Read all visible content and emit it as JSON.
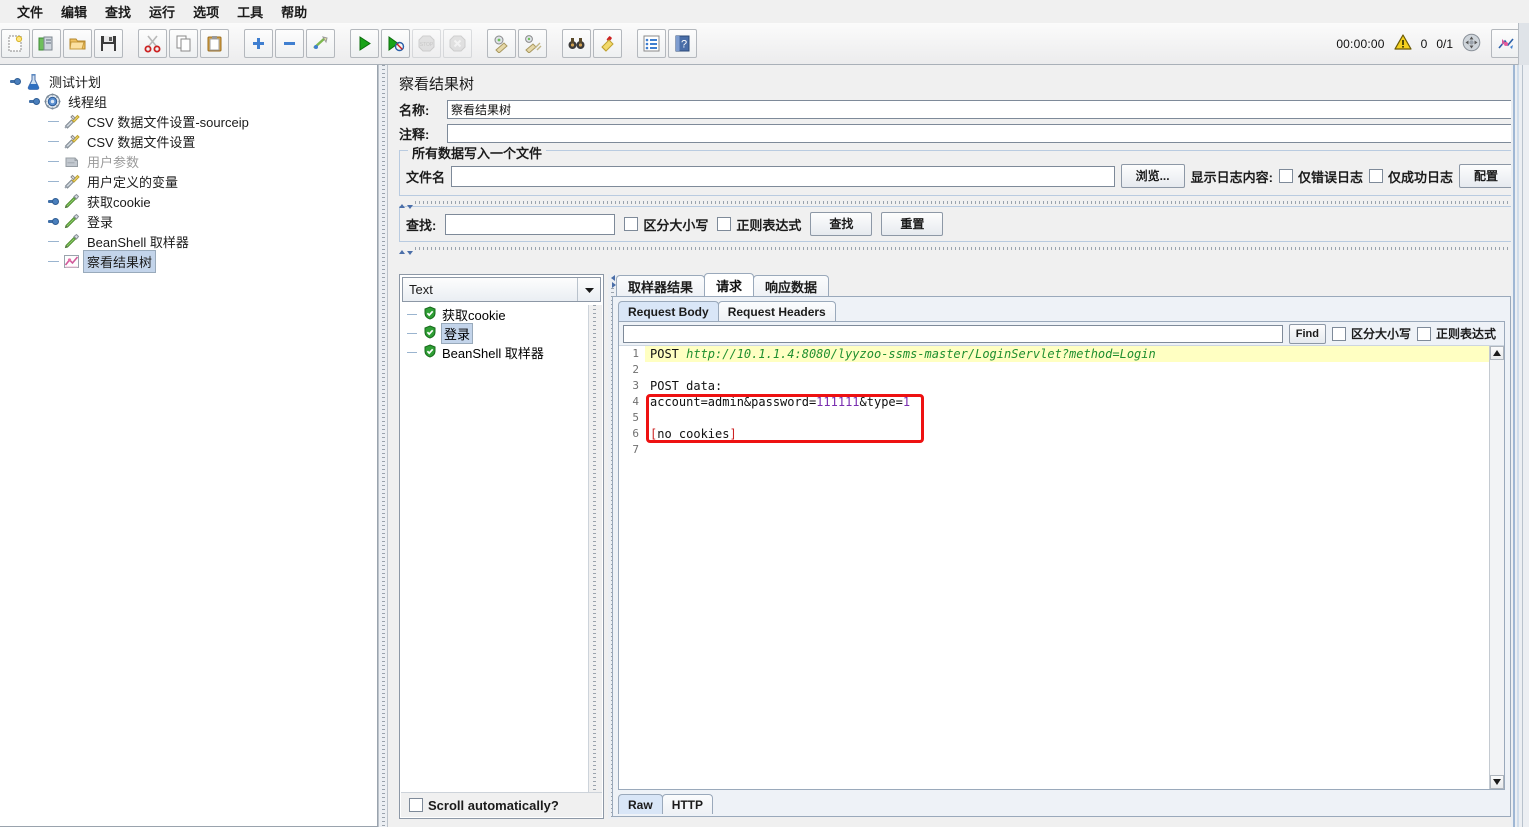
{
  "menu": {
    "items": [
      {
        "label": "文件",
        "name": "menu-file"
      },
      {
        "label": "编辑",
        "name": "menu-edit"
      },
      {
        "label": "查找",
        "name": "menu-search"
      },
      {
        "label": "运行",
        "name": "menu-run"
      },
      {
        "label": "选项",
        "name": "menu-options"
      },
      {
        "label": "工具",
        "name": "menu-tools"
      },
      {
        "label": "帮助",
        "name": "menu-help"
      }
    ]
  },
  "toolbar": {
    "buttons": [
      {
        "icon": "new-file-icon",
        "enabled": true
      },
      {
        "icon": "templates-icon",
        "enabled": true
      },
      {
        "icon": "open-folder-icon",
        "enabled": true
      },
      {
        "icon": "save-icon",
        "enabled": true
      },
      {
        "icon": "cut-scissors-icon",
        "enabled": true
      },
      {
        "icon": "copy-icon",
        "enabled": true
      },
      {
        "icon": "paste-clipboard-icon",
        "enabled": true
      },
      {
        "icon": "expand-plus-icon",
        "enabled": true
      },
      {
        "icon": "collapse-minus-icon",
        "enabled": true
      },
      {
        "icon": "toggle-icon",
        "enabled": true
      },
      {
        "icon": "start-play-icon",
        "enabled": true
      },
      {
        "icon": "start-no-pauses-icon",
        "enabled": true
      },
      {
        "icon": "stop-icon",
        "enabled": false
      },
      {
        "icon": "shutdown-icon",
        "enabled": false
      },
      {
        "icon": "clear-icon",
        "enabled": true
      },
      {
        "icon": "clear-all-icon",
        "enabled": true
      },
      {
        "icon": "search-binoculars-icon",
        "enabled": true
      },
      {
        "icon": "search-reset-broom-icon",
        "enabled": true
      },
      {
        "icon": "function-helper-list-icon",
        "enabled": true
      },
      {
        "icon": "help-book-icon",
        "enabled": true
      }
    ],
    "status": {
      "elapsed": "00:00:00",
      "warning_icon": "warning-triangle-icon",
      "warning_count": "0",
      "threads": "0/1",
      "remote_icon": "remote-status-icon",
      "right_icon": "jmeter-logo-icon"
    }
  },
  "tree": {
    "nodes": [
      {
        "label": "测试计划",
        "icon": "test-plan-icon",
        "depth": 0,
        "selected": false,
        "expandable": true,
        "muted": false
      },
      {
        "label": "线程组",
        "icon": "thread-group-icon",
        "depth": 1,
        "selected": false,
        "expandable": true,
        "muted": false
      },
      {
        "label": "CSV 数据文件设置-sourceip",
        "icon": "config-element-icon",
        "depth": 2,
        "selected": false,
        "expandable": false,
        "muted": false
      },
      {
        "label": "CSV 数据文件设置",
        "icon": "config-element-icon",
        "depth": 2,
        "selected": false,
        "expandable": false,
        "muted": false
      },
      {
        "label": "用户参数",
        "icon": "user-parameters-icon",
        "depth": 2,
        "selected": false,
        "expandable": false,
        "muted": true
      },
      {
        "label": "用户定义的变量",
        "icon": "config-element-icon",
        "depth": 2,
        "selected": false,
        "expandable": false,
        "muted": false
      },
      {
        "label": "获取cookie",
        "icon": "sampler-icon",
        "depth": 2,
        "selected": false,
        "expandable": true,
        "muted": false
      },
      {
        "label": "登录",
        "icon": "sampler-icon",
        "depth": 2,
        "selected": false,
        "expandable": true,
        "muted": false
      },
      {
        "label": "BeanShell 取样器",
        "icon": "sampler-icon",
        "depth": 2,
        "selected": false,
        "expandable": false,
        "muted": false
      },
      {
        "label": "察看结果树",
        "icon": "view-results-tree-icon",
        "depth": 2,
        "selected": true,
        "expandable": false,
        "muted": false
      }
    ]
  },
  "panel": {
    "title": "察看结果树",
    "name_label": "名称:",
    "name_value": "察看结果树",
    "comment_label": "注释:",
    "comment_value": "",
    "filegroup": {
      "title": "所有数据写入一个文件",
      "filename_label": "文件名",
      "filename_value": "",
      "browse_button": "浏览...",
      "log_label": "显示日志内容:",
      "errors_only": "仅错误日志",
      "success_only": "仅成功日志",
      "configure_button": "配置"
    },
    "searchbar": {
      "label": "查找:",
      "value": "",
      "case_sensitive": "区分大小写",
      "regex": "正则表达式",
      "find_button": "查找",
      "reset_button": "重置"
    }
  },
  "results": {
    "renderer_selected": "Text",
    "renderer_icon": "chevron-down-icon",
    "items": [
      {
        "label": "获取cookie",
        "status": "success",
        "selected": false
      },
      {
        "label": "登录",
        "status": "success",
        "selected": true
      },
      {
        "label": "BeanShell 取样器",
        "status": "success",
        "selected": false
      }
    ],
    "scroll_auto_label": "Scroll automatically?",
    "scroll_auto_checked": false
  },
  "detail": {
    "tabs": [
      {
        "label": "取样器结果",
        "active": false
      },
      {
        "label": "请求",
        "active": true
      },
      {
        "label": "响应数据",
        "active": false
      }
    ],
    "subtabs": [
      {
        "label": "Request Body",
        "active": true
      },
      {
        "label": "Request Headers",
        "active": false
      }
    ],
    "find": {
      "value": "",
      "find_button": "Find",
      "case_sensitive": "区分大小写",
      "regex": "正则表达式"
    },
    "bottom_tabs": [
      {
        "label": "Raw",
        "active": true
      },
      {
        "label": "HTTP",
        "active": false
      }
    ],
    "code_lines": [
      {
        "num": "1",
        "highlight": true,
        "segments": [
          {
            "text": "POST ",
            "style": "plain"
          },
          {
            "text": "http://10.1.1.4:8080/lyyzoo-ssms-master/LoginServlet?method=Login",
            "style": "green"
          }
        ]
      },
      {
        "num": "2",
        "highlight": false,
        "segments": []
      },
      {
        "num": "3",
        "highlight": false,
        "segments": [
          {
            "text": "POST data:",
            "style": "plain"
          }
        ]
      },
      {
        "num": "4",
        "highlight": false,
        "segments": [
          {
            "text": "account=admin&password=",
            "style": "plain"
          },
          {
            "text": "111111",
            "style": "purple"
          },
          {
            "text": "&type=",
            "style": "plain"
          },
          {
            "text": "1",
            "style": "purple"
          }
        ]
      },
      {
        "num": "5",
        "highlight": false,
        "segments": []
      },
      {
        "num": "6",
        "highlight": false,
        "segments": [
          {
            "text": "[",
            "style": "red"
          },
          {
            "text": "no cookies",
            "style": "plain"
          },
          {
            "text": "]",
            "style": "red"
          }
        ]
      },
      {
        "num": "7",
        "highlight": false,
        "segments": []
      }
    ],
    "annotation_box_color": "#ee1111"
  }
}
